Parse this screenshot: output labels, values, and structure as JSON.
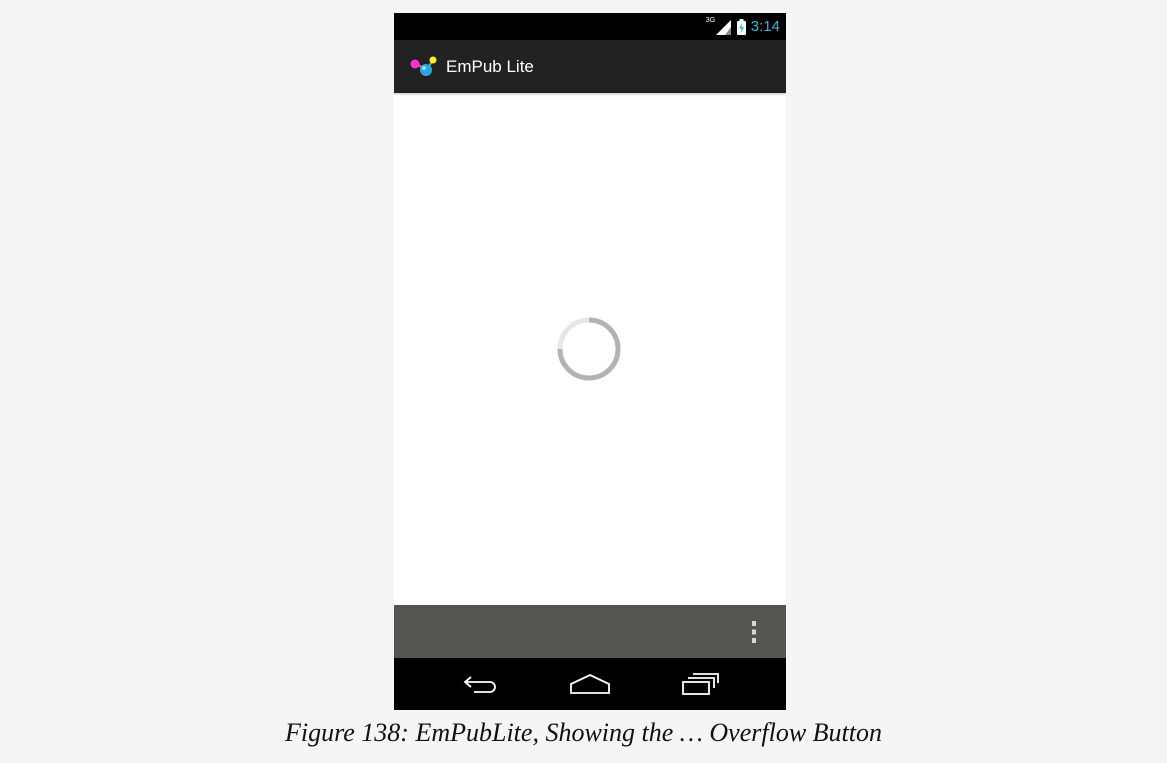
{
  "status_bar": {
    "network_type": "3G",
    "time": "3:14",
    "icons": [
      "signal-icon",
      "battery-charging-icon"
    ],
    "time_color": "#33b5e5"
  },
  "action_bar": {
    "app_icon": "empub-logo-icon",
    "title": "EmPub Lite",
    "background": "#222222"
  },
  "content": {
    "state": "loading",
    "indicator": "progress-spinner-icon"
  },
  "split_action_bar": {
    "background": "#545552",
    "overflow_icon": "overflow-menu-icon"
  },
  "navigation_bar": {
    "buttons": [
      "back-icon",
      "home-icon",
      "recent-apps-icon"
    ]
  },
  "caption": "Figure 138: EmPubLite, Showing the … Overflow Button"
}
